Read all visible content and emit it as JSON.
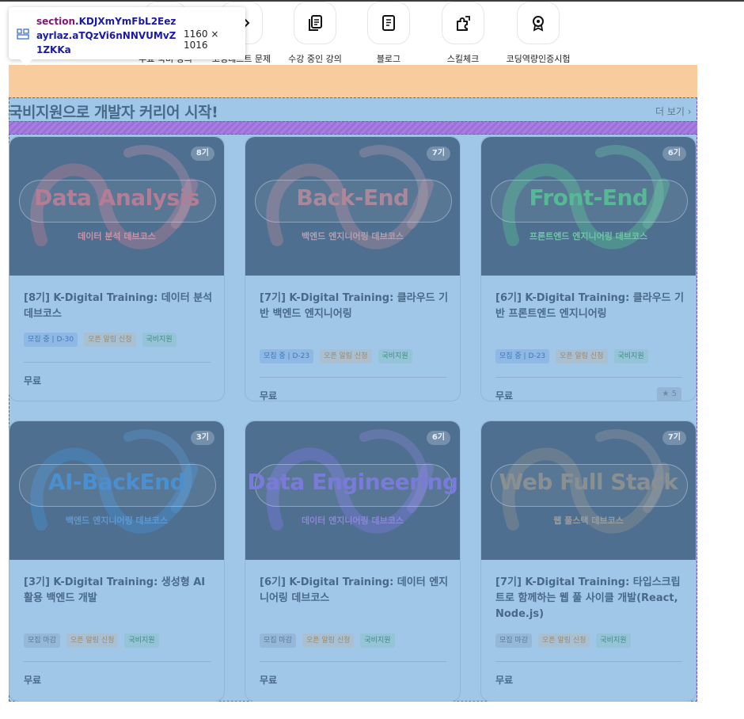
{
  "nav": [
    {
      "label": "무료 국비 강의",
      "icon": "book-icon"
    },
    {
      "label": "코딩테스트 문제",
      "icon": "code-icon"
    },
    {
      "label": "수강 중인 강의",
      "icon": "copy-icon"
    },
    {
      "label": "블로그",
      "icon": "document-icon"
    },
    {
      "label": "스킬체크",
      "icon": "puzzle-icon"
    },
    {
      "label": "코딩역량인증시험",
      "icon": "award-icon"
    }
  ],
  "tooltip": {
    "tag": "section",
    "selector_rest": ".KDJXmYmFbL2Eezayrlaz.aTQzVi6nNNVUMvZ1ZKKa",
    "size": "1160 × 1016"
  },
  "section": {
    "title": "국비지원으로 개발자 커리어 시작!",
    "more": "더 보기"
  },
  "cards": [
    {
      "badge": "8기",
      "thumb_title": "Data Analysis",
      "thumb_sub": "데이터 분석 데브코스",
      "title": "[8기] K-Digital Training: 데이터 분석 데브코스",
      "tags": [
        "모집 중 | D-30",
        "오픈 알림 신청",
        "국비지원"
      ],
      "price": "무료",
      "title_color": "#b47d96",
      "sub_color": "#c495ab"
    },
    {
      "badge": "7기",
      "thumb_title": "Back-End",
      "thumb_sub": "백엔드 엔지니어링 데브코스",
      "title": "[7기] K-Digital Training: 클라우드 기반 백엔드 엔지니어링",
      "tags": [
        "모집 중 | D-23",
        "오픈 알림 신청",
        "국비지원"
      ],
      "price": "무료",
      "title_color": "#a8889a",
      "sub_color": "#b49fb0"
    },
    {
      "badge": "6기",
      "thumb_title": "Front-End",
      "thumb_sub": "프론트엔드 엔지니어링 데브코스",
      "title": "[6기] K-Digital Training: 클라우드 기반 프론트엔드 엔지니어링",
      "tags": [
        "모집 중 | D-23",
        "오픈 알림 신청",
        "국비지원"
      ],
      "price": "무료",
      "rating": "★ 5",
      "title_color": "#56b894",
      "sub_color": "#6fc6a6"
    },
    {
      "badge": "3기",
      "thumb_title": "AI-BackEnd",
      "thumb_sub": "백엔드 엔지니어링 데브코스",
      "title": "[3기] K-Digital Training: 생성형 AI 활용 백엔드 개발",
      "tags": [
        "모집 마감",
        "오픈 알림 신청",
        "국비지원"
      ],
      "price": "무료",
      "title_color": "#4a8fd0",
      "sub_color": "#5c9ad6"
    },
    {
      "badge": "6기",
      "thumb_title": "Data Engineering",
      "thumb_sub": "데이터 엔지니어링 데브코스",
      "title": "[6기] K-Digital Training: 데이터 엔지니어링 데브코스",
      "tags": [
        "모집 마감",
        "오픈 알림 신청",
        "국비지원"
      ],
      "price": "무료",
      "title_color": "#7a7adb",
      "sub_color": "#8c86d8"
    },
    {
      "badge": "7기",
      "thumb_title": "Web Full Stack",
      "thumb_sub": "웹 풀스택 데브코스",
      "title": "[7기] K-Digital Training: 타입스크립트로 함께하는 웹 풀 사이클 개발(React, Node.js)",
      "tags": [
        "모집 마감",
        "오픈 알림 신청",
        "국비지원"
      ],
      "price": "무료",
      "title_color": "#8a8f92",
      "sub_color": "#9a9ea0"
    }
  ]
}
